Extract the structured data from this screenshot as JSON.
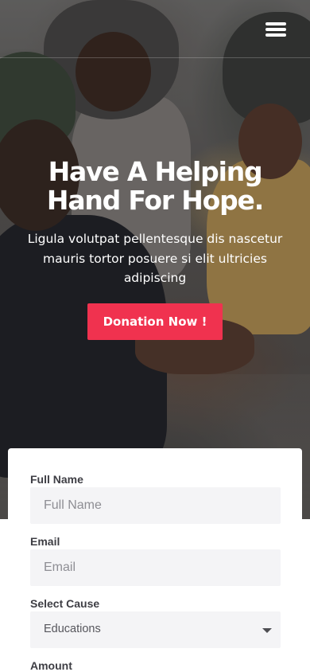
{
  "hero": {
    "title_line1": "Have A Helping",
    "title_line2": "Hand For Hope.",
    "subtitle": "Ligula volutpat pellentesque dis nascetur mauris tortor posuere si elit ultricies adipiscing",
    "cta_label": "Donation Now !",
    "cta_color": "#f0324f"
  },
  "header": {
    "menu_icon": "hamburger-menu-icon"
  },
  "form": {
    "full_name": {
      "label": "Full Name",
      "placeholder": "Full Name",
      "value": ""
    },
    "email": {
      "label": "Email",
      "placeholder": "Email",
      "value": ""
    },
    "cause": {
      "label": "Select Cause",
      "selected": "Educations",
      "icon": "caret-down-icon"
    },
    "amount": {
      "label": "Amount"
    }
  }
}
